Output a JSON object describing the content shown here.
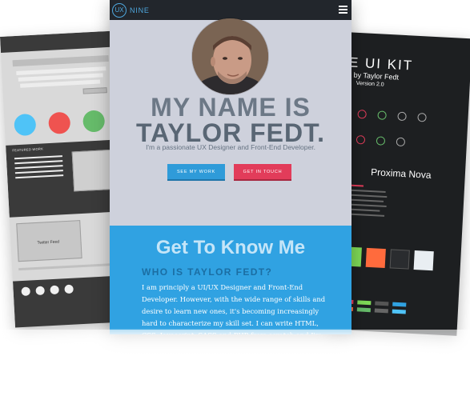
{
  "wireframe": {
    "featured_label": "FEATURED WORK",
    "feed_label": "Twitter Feed",
    "circle_colors": [
      "#4fc3f7",
      "#ef5350",
      "#66bb6a"
    ]
  },
  "ui_kit": {
    "title": "E UI KIT",
    "byline": "ed by Taylor Fedt",
    "version": "Version 2.0",
    "font_name": "Proxima Nova",
    "logo_text": "NINE",
    "swatch_colors": [
      "#7ed957",
      "#ff6b3d",
      "#2a2c2f",
      "#e9eef2"
    ]
  },
  "brand": {
    "mark": "UX",
    "name": "NINE"
  },
  "hero": {
    "headline_line1": "MY NAME IS",
    "headline_line2": "TAYLOR FEDT.",
    "tagline": "I'm a passionate UX Designer and Front-End Developer.",
    "btn_work": "SEE MY WORK",
    "btn_touch": "GET IN TOUCH"
  },
  "about": {
    "title": "Get To Know Me",
    "subtitle": "WHO IS TAYLOR FEDT?",
    "body": "I am principly a UI/UX Designer and Front-End Developer. However, with the wide range of skills and desire to learn new ones, it's becoming increasingly hard to characterize my skill set. I can write HTML, CSS, Javascript, SASS and PHP from scratch and I'm comfortable setting up databases and working with server-side"
  },
  "colors": {
    "accent_blue": "#30a2e2",
    "accent_red": "#e23c5a",
    "nav_dark": "#22262c"
  }
}
